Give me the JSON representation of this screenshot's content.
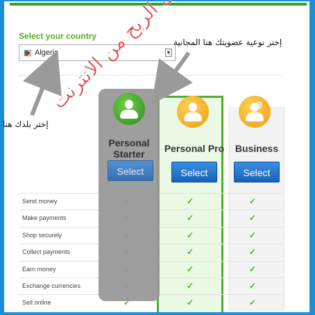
{
  "country": {
    "label": "Select your country",
    "selected": "Algeria",
    "arrow_glyph": "▼"
  },
  "annotations": {
    "top": "إختر نوعية عضويتك هنا المجانية",
    "left": "إختر بلدك هنا"
  },
  "plans": [
    {
      "name": "Personal Starter",
      "button": "Select"
    },
    {
      "name": "Personal Pro",
      "button": "Select"
    },
    {
      "name": "Business",
      "button": "Select"
    }
  ],
  "features": [
    "Send money",
    "Make payments",
    "Shop securely",
    "Collect payments",
    "Earn money",
    "Exchange currencies",
    "Sell online"
  ],
  "check_glyph": "✓",
  "watermark": "منتدى الربح من الانترنت",
  "colors": {
    "frame_border": "#1a8fd8",
    "accent_green": "#4caf2d",
    "button_blue": "#1a73c9",
    "watermark_red": "#dc2828"
  }
}
